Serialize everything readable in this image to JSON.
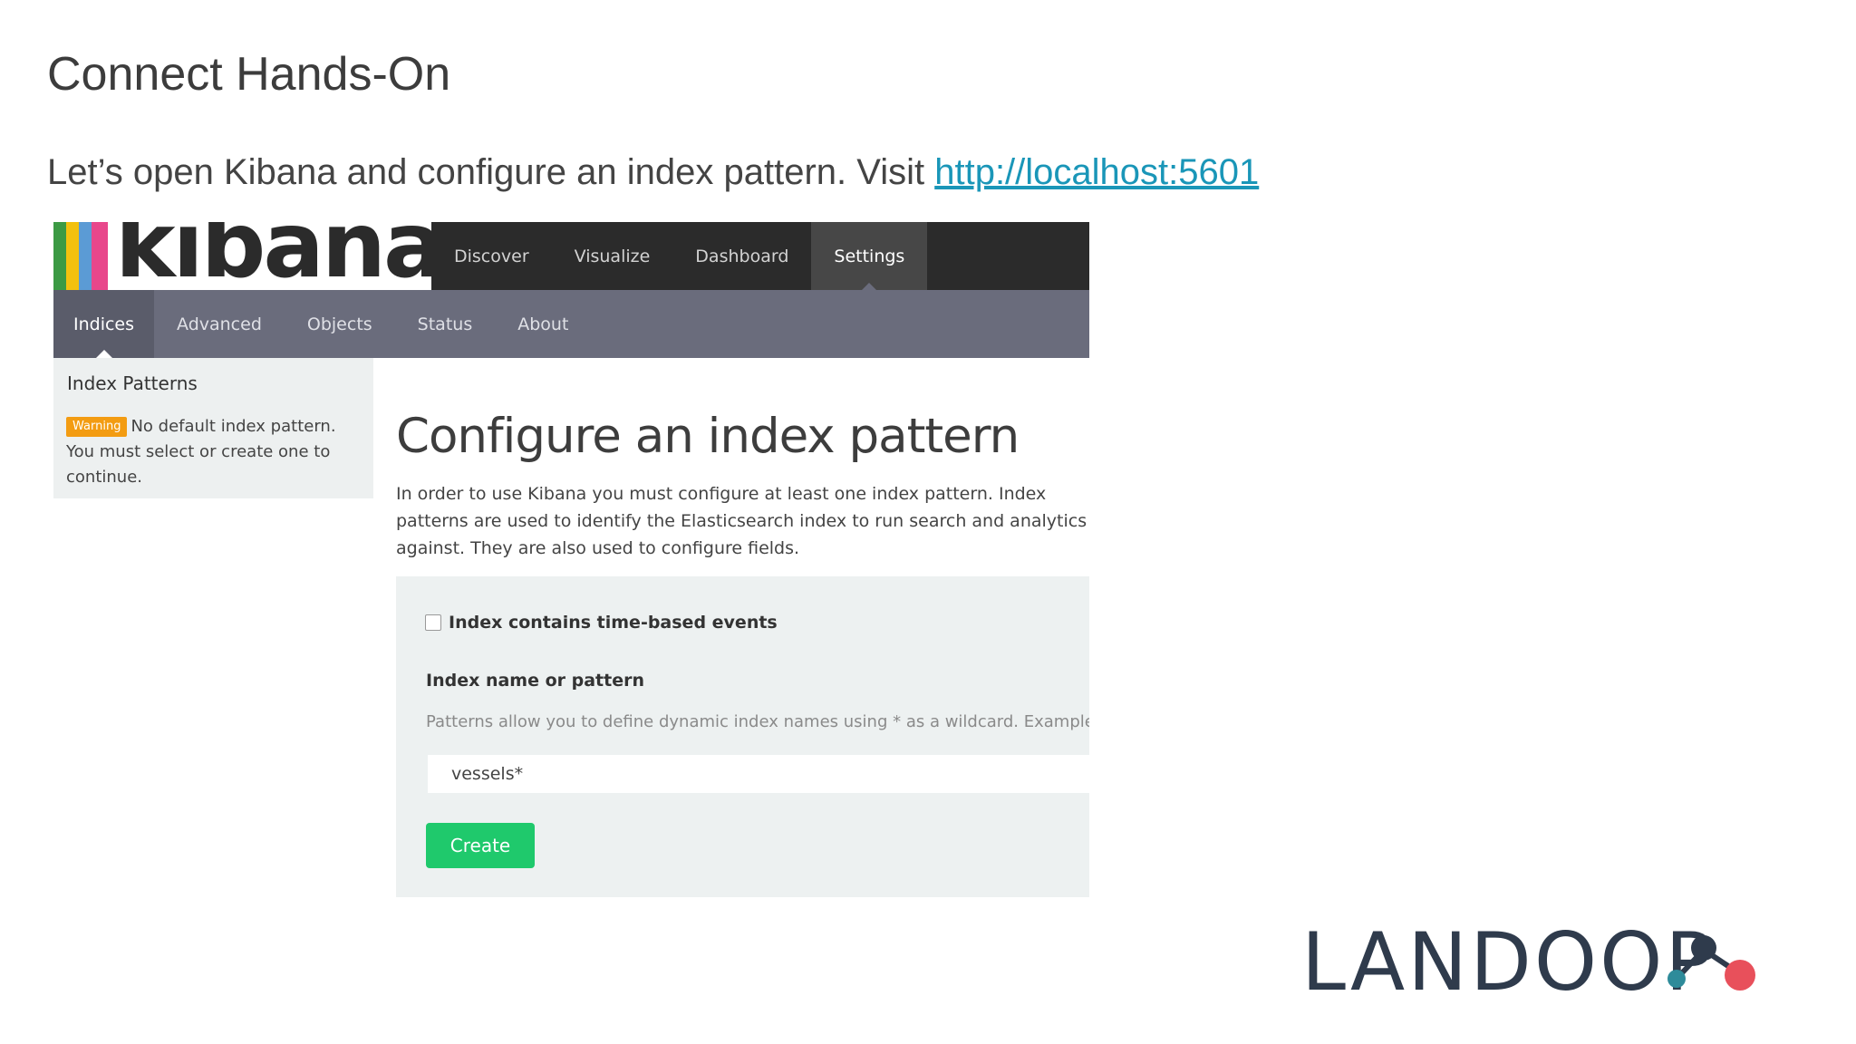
{
  "slide": {
    "title": "Connect Hands-On",
    "intro_text": "Let’s open Kibana and configure an index pattern. Visit ",
    "intro_link": "http://localhost:5601"
  },
  "kibana": {
    "logo_text": "kibana",
    "logo_stripe_colors": [
      "#3c9a44",
      "#f3c10f",
      "#5b9bd5",
      "#e8478b"
    ],
    "top_nav": [
      "Discover",
      "Visualize",
      "Dashboard",
      "Settings"
    ],
    "top_nav_active": "Settings",
    "sub_nav": [
      "Indices",
      "Advanced",
      "Objects",
      "Status",
      "About"
    ],
    "sub_nav_active": "Indices",
    "sidebar": {
      "title": "Index Patterns",
      "badge": "Warning",
      "warning_text": "No default index pattern. You must select or create one to continue."
    },
    "main": {
      "title": "Configure an index pattern",
      "description": "In order to use Kibana you must configure at least one index pattern. Index patterns are used to identify the Elasticsearch index to run search and analytics against. They are also used to configure fields.",
      "checkbox_label": "Index contains time-based events",
      "checkbox_checked": false,
      "field_label": "Index name or pattern",
      "field_help": "Patterns allow you to define dynamic index names using * as a wildcard. Example: logstash-*",
      "field_value": "vessels*",
      "create_label": "Create"
    }
  },
  "brand": {
    "name": "LANDOOP",
    "colors": {
      "teal": "#2e8b9a",
      "navy": "#2f3b4c",
      "red": "#e8505b"
    }
  }
}
